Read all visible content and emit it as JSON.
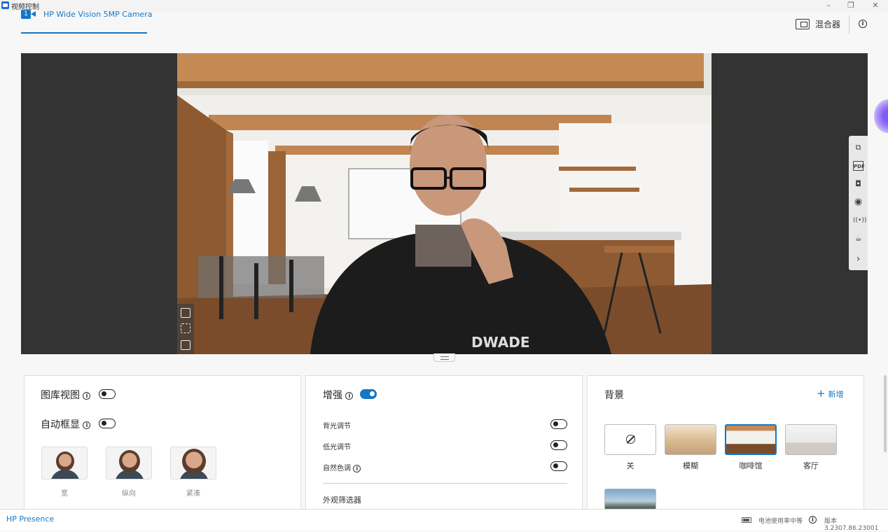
{
  "window": {
    "title": "视频控制",
    "controls": [
      "–",
      "❐",
      "✕"
    ]
  },
  "header": {
    "camera_tab": {
      "number": "1",
      "label": "HP Wide Vision 5MP Camera"
    },
    "mixer_label": "混合器"
  },
  "side_toolbar": [
    "expand-icon",
    "pdf-icon",
    "camera-icon",
    "record-icon",
    "broadcast-icon",
    "coffee-icon",
    "chevron-right-icon"
  ],
  "video": {
    "shirt_text": "DWADE"
  },
  "panel_gallery": {
    "gallery_view": {
      "label": "图库视图",
      "on": false
    },
    "auto_frame": {
      "label": "自动框显",
      "on": false
    },
    "framing": [
      {
        "label": "宽"
      },
      {
        "label": "纵向"
      },
      {
        "label": "紧凑"
      }
    ]
  },
  "panel_enhance": {
    "title": "增强",
    "on": true,
    "options": [
      {
        "label": "背光调节",
        "on": false
      },
      {
        "label": "低光调节",
        "on": false
      },
      {
        "label": "自然色调",
        "on": false
      }
    ],
    "filters_label": "外观筛选器"
  },
  "panel_background": {
    "title": "背景",
    "add_label": "新增",
    "tiles": [
      {
        "label": "关",
        "selected": false
      },
      {
        "label": "模糊",
        "selected": false
      },
      {
        "label": "咖啡馆",
        "selected": true
      },
      {
        "label": "客厅",
        "selected": false
      },
      {
        "label": "",
        "selected": false
      }
    ]
  },
  "statusbar": {
    "brand": "HP Presence",
    "battery": "电池使用率中等",
    "version": "版本 3.2307.86.23001"
  },
  "colors": {
    "accent": "#1677c5",
    "video_bg": "#333333"
  }
}
